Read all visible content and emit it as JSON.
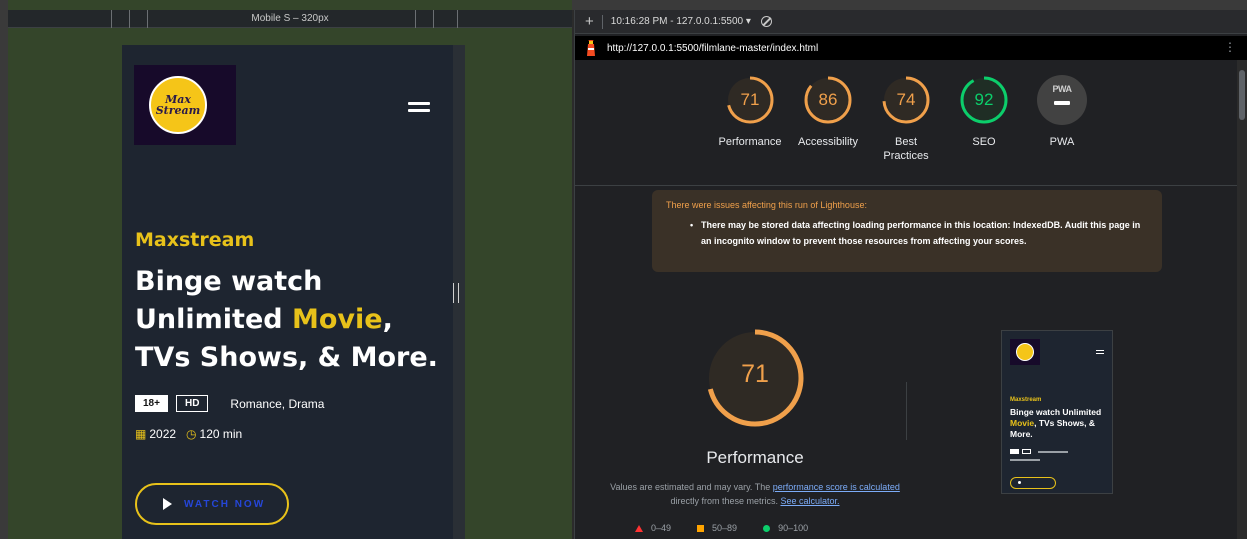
{
  "devtools": {
    "device_label": "Mobile S – 320px"
  },
  "site": {
    "logo_line1": "Max",
    "logo_line2": "Stream",
    "brand": "Maxstream",
    "headline_part1": "Binge watch Unlimited ",
    "headline_highlight": "Movie",
    "headline_part2": ", TVs Shows, & More.",
    "badge_age": "18+",
    "badge_quality": "HD",
    "genres": "Romance,  Drama",
    "year": "2022",
    "duration": "120 min",
    "watch_button": "WATCH NOW"
  },
  "lighthouse": {
    "run_label": "10:16:28 PM - 127.0.0.1:5500 ▾",
    "url": "http://127.0.0.1:5500/filmlane-master/index.html",
    "more_label": "⋮",
    "gauges": [
      {
        "label": "Performance",
        "score": 71,
        "color": "#f0a04b"
      },
      {
        "label": "Accessibility",
        "score": 86,
        "color": "#f0a04b"
      },
      {
        "label": "Best Practices",
        "score": 74,
        "color": "#f0a04b"
      },
      {
        "label": "SEO",
        "score": 92,
        "color": "#0cce6b"
      }
    ],
    "pwa": {
      "badge": "PWA",
      "label": "PWA"
    },
    "warning": {
      "title": "There were issues affecting this run of Lighthouse:",
      "item": "There may be stored data affecting loading performance in this location: IndexedDB. Audit this page in an incognito window to prevent those resources from affecting your scores."
    },
    "performance": {
      "score": 71,
      "title": "Performance",
      "note_part1": "Values are estimated and may vary. The ",
      "note_link1": "performance score is calculated",
      "note_part2": " directly from these metrics. ",
      "note_link2": "See calculator."
    },
    "legend": [
      {
        "range": "0–49"
      },
      {
        "range": "50–89"
      },
      {
        "range": "90–100"
      }
    ]
  }
}
